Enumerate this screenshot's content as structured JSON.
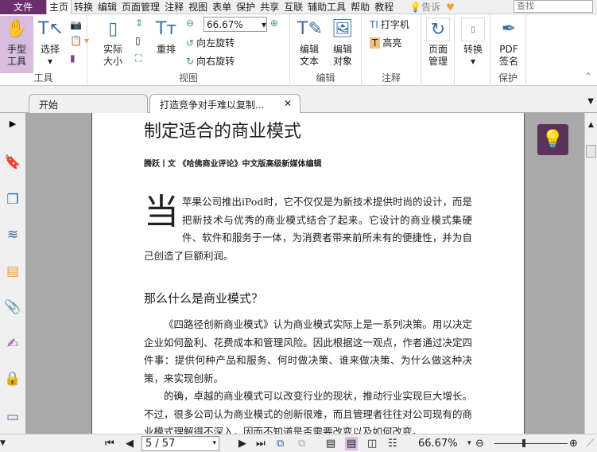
{
  "menu": {
    "file": "文件",
    "items": [
      "主页",
      "转换",
      "编辑",
      "页面管理",
      "注释",
      "视图",
      "表单",
      "保护",
      "共享",
      "互联",
      "辅助工具",
      "帮助",
      "教程"
    ],
    "tell": "告诉",
    "search_placeholder": "查找"
  },
  "ribbon": {
    "tools": {
      "hand": "手型\n工具",
      "select": "选择",
      "label": "工具"
    },
    "view": {
      "actual": "实际\n大小",
      "reflow": "重排",
      "zoom": "66.67%",
      "rotate_left": "向左旋转",
      "rotate_right": "向右旋转",
      "label": "视图"
    },
    "edit": {
      "edit_text": "编辑\n文本",
      "edit_object": "编辑\n对象",
      "label": "编辑"
    },
    "comment": {
      "typewriter": "打字机",
      "highlight": "高亮",
      "label": "注释"
    },
    "page": {
      "manage": "页面\n管理"
    },
    "convert": {
      "label": "转换"
    },
    "protect": {
      "sign": "PDF\n签名",
      "label": "保护"
    }
  },
  "tabs": [
    {
      "label": "开始"
    },
    {
      "label": "打造竞争对手难以复制..."
    }
  ],
  "document": {
    "title": "制定适合的商业模式",
    "byline": "腾跃丨文 《哈佛商业评论》中文版高级新媒体编辑",
    "drop_cap": "当",
    "para1": "苹果公司推出iPod时，它不仅仅是为新技术提供时尚的设计，而是把新技术与优秀的商业模式结合了起来。它设计的商业模式集硬件、软件和服务于一体，为消费者带来前所未有的便捷性，并为自己创造了巨额利润。",
    "heading": "那么什么是商业模式？",
    "para2": "《四路径创新商业模式》认为商业模式实际上是一系列决策。用以决定企业如何盈利、花费成本和管理风险。因此根据这一观点，作者通过决定四件事：提供何种产品和服务、何时做决策、谁来做决策、为什么做这种决策，来实现创新。",
    "para3": "的确，卓越的商业模式可以改变行业的现状，推动行业实现巨大增长。不过，很多公司认为商业模式的创新很难，而且管理者往往对公司现有的商业模式理解得不深入，因而不知道是否需要改变以及如何改变。"
  },
  "statusbar": {
    "page": "5 / 57",
    "zoom": "66.67%",
    "zoom_slider_fraction": 0.4
  },
  "colors": {
    "brand": "#6b2f6e",
    "tip": "#5a3458"
  }
}
